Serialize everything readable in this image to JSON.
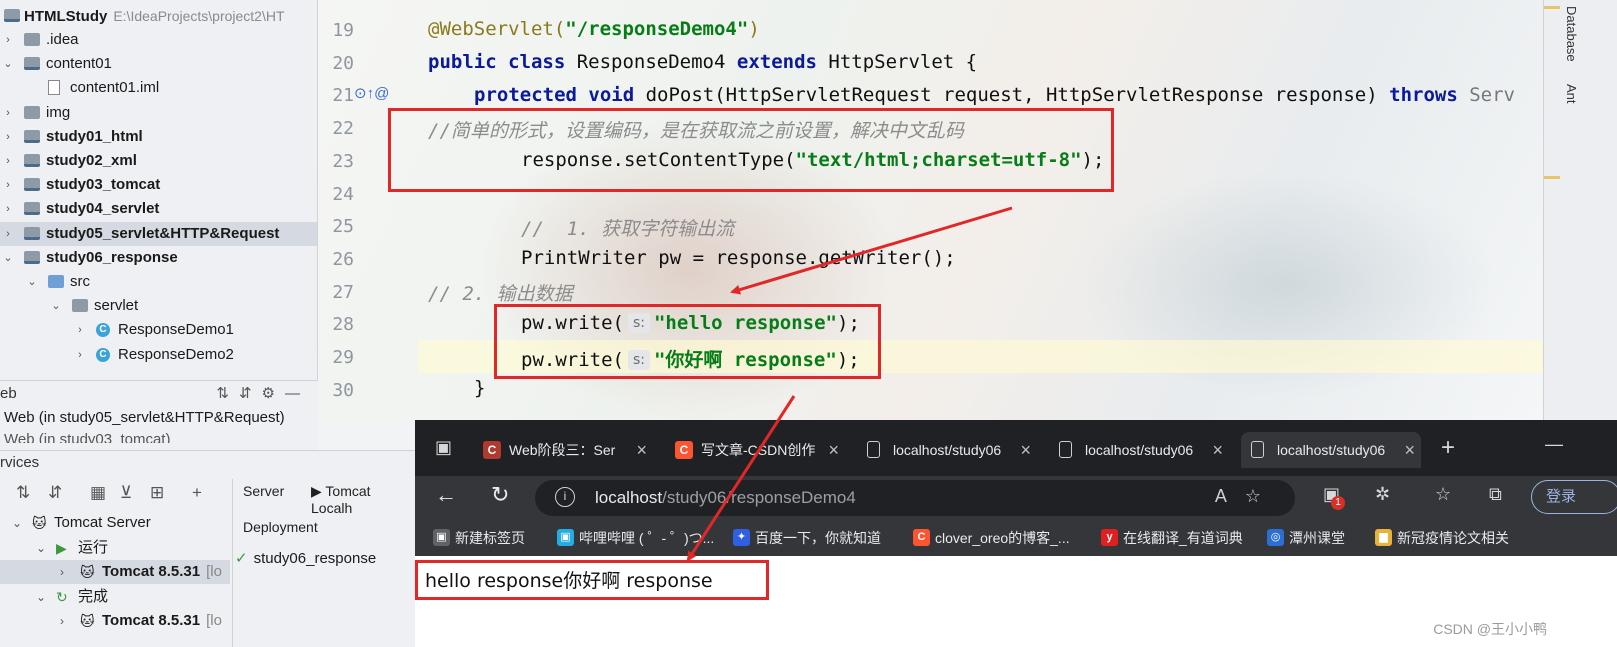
{
  "project": {
    "root_name": "HTMLStudy",
    "root_path": "E:\\IdeaProjects\\project2\\HT",
    "items": [
      {
        "label": ".idea",
        "arrow": "›",
        "icon": "folder"
      },
      {
        "label": "content01",
        "arrow": "⌄",
        "icon": "folder-module"
      },
      {
        "label": "content01.iml",
        "arrow": "",
        "icon": "iml-file"
      },
      {
        "label": "img",
        "arrow": "›",
        "icon": "folder"
      },
      {
        "label": "study01_html",
        "arrow": "›",
        "icon": "folder-module"
      },
      {
        "label": "study02_xml",
        "arrow": "›",
        "icon": "folder-module"
      },
      {
        "label": "study03_tomcat",
        "arrow": "›",
        "icon": "folder-module"
      },
      {
        "label": "study04_servlet",
        "arrow": "›",
        "icon": "folder-module"
      },
      {
        "label": "study05_servlet&HTTP&Request",
        "arrow": "›",
        "icon": "folder-module"
      },
      {
        "label": "study06_response",
        "arrow": "⌄",
        "icon": "folder-module"
      },
      {
        "label": "src",
        "arrow": "⌄",
        "icon": "folder-source"
      },
      {
        "label": "servlet",
        "arrow": "⌄",
        "icon": "package"
      },
      {
        "label": "ResponseDemo1",
        "arrow": "›",
        "icon": "class"
      },
      {
        "label": "ResponseDemo2",
        "arrow": "›",
        "icon": "class"
      }
    ]
  },
  "editor": {
    "line_numbers": [
      "19",
      "20",
      "21",
      "22",
      "23",
      "24",
      "25",
      "26",
      "27",
      "28",
      "29",
      "30"
    ],
    "hint_label": "s:",
    "gutter_icons": "⊙↑@",
    "code": {
      "l19_annotation": "@WebServlet(",
      "l19_string": "\"/responseDemo4\"",
      "l19_close": ")",
      "l20_kw1": "public class",
      "l20_name": " ResponseDemo4 ",
      "l20_kw2": "extends",
      "l20_rest": " HttpServlet {",
      "l21_kw": "protected void",
      "l21_rest": " doPost(HttpServletRequest request, HttpServletResponse response) ",
      "l21_throws": "throws",
      "l21_tail": " Serv",
      "l22_comment": "//简单的形式，设置编码，是在获取流之前设置，解决中文乱码",
      "l23_code": "response.setContentType(",
      "l23_string": "\"text/html;charset=utf-8\"",
      "l23_close": ");",
      "l25_comment": "//  1. 获取字符输出流",
      "l26_code": "PrintWriter pw = response.getWriter();",
      "l27_comment": "// 2. 输出数据",
      "l28_code": "pw.write(",
      "l28_string": "\"hello response\"",
      "l28_close": ");",
      "l29_code": "pw.write(",
      "l29_string": "\"你好啊 response\"",
      "l29_close": ");",
      "l30_code": "}"
    }
  },
  "right_strip": {
    "tabs": [
      "Database",
      "Ant"
    ]
  },
  "web_panel": {
    "title": "eb",
    "items": [
      "Web (in study05_servlet&HTTP&Request)",
      "Web (in study03_tomcat)"
    ]
  },
  "services": {
    "title": "rvices",
    "toolbar_icons": [
      "⇅",
      "⇵",
      "▦",
      "⊻",
      "⊞",
      "+"
    ],
    "tree": [
      {
        "label": "Tomcat Server",
        "arrow": "⌄"
      },
      {
        "label": "运行",
        "arrow": "⌄"
      },
      {
        "label": "Tomcat 8.5.31",
        "suffix": "[lo",
        "arrow": "›"
      },
      {
        "label": "完成",
        "arrow": "⌄"
      },
      {
        "label": "Tomcat 8.5.31",
        "suffix": "[lo",
        "arrow": "›"
      }
    ],
    "tab_server": "Server",
    "tab_log": "Tomcat Localh",
    "deployment_label": "Deployment",
    "deployment_item": "study06_response"
  },
  "browser": {
    "tabs": [
      {
        "title": "Web阶段三：Ser",
        "icon_text": "C",
        "icon_color": "#b03a2e"
      },
      {
        "title": "写文章-CSDN创作",
        "icon_text": "C",
        "icon_color": "#fc5531"
      },
      {
        "title": "localhost/study06",
        "icon_text": "",
        "icon_color": ""
      },
      {
        "title": "localhost/study06",
        "icon_text": "",
        "icon_color": ""
      },
      {
        "title": "localhost/study06",
        "icon_text": "",
        "icon_color": ""
      }
    ],
    "new_tab": "+",
    "url_host": "localhost",
    "url_path": "/study06/responseDemo4",
    "login_label": "登录",
    "extension_badge": "1",
    "bookmarks": [
      {
        "label": "新建标签页",
        "icon_text": "▣",
        "icon_color": "#5f6368"
      },
      {
        "label": "哔哩哔哩 ( ゜- ゜)つ...",
        "icon_text": "▣",
        "icon_color": "#23ade5"
      },
      {
        "label": "百度一下，你就知道",
        "icon_text": "✦",
        "icon_color": "#2f5fe3"
      },
      {
        "label": "clover_oreo的博客_...",
        "icon_text": "C",
        "icon_color": "#fc5531"
      },
      {
        "label": "在线翻译_有道词典",
        "icon_text": "y",
        "icon_color": "#e02020"
      },
      {
        "label": "潭州课堂",
        "icon_text": "◎",
        "icon_color": "#2a6fd1"
      },
      {
        "label": "新冠疫情论文相关",
        "icon_text": "▆",
        "icon_color": "#e8b339"
      }
    ],
    "page_text": "hello response你好啊 response"
  },
  "watermark": "CSDN @王小小鸭",
  "colors": {
    "annotation_box": "#e02828",
    "arrow": "#e02828"
  }
}
